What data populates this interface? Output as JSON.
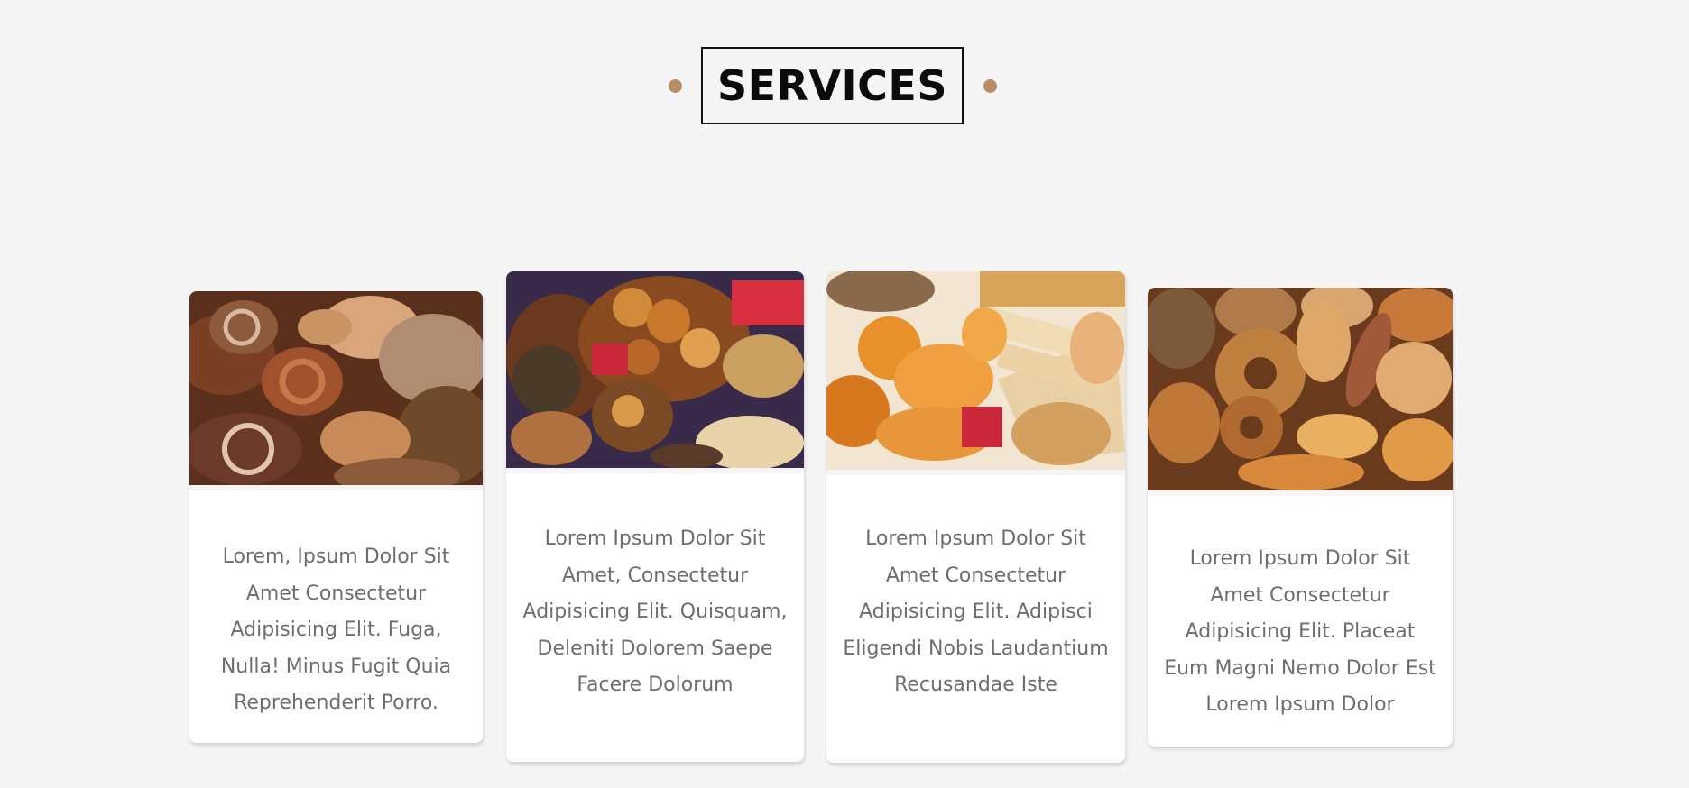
{
  "section": {
    "title": "SERVICES"
  },
  "cards": [
    {
      "image_icon": "bread-photo-icon",
      "text": "Lorem, Ipsum Dolor Sit Amet Consectetur Adipisicing Elit. Fuga, Nulla! Minus Fugit Quia Reprehenderit Porro."
    },
    {
      "image_icon": "bread-basket-photo-icon",
      "text": "Lorem Ipsum Dolor Sit Amet, Consectetur Adipisicing Elit. Quisquam, Deleniti Dolorem Saepe Facere Dolorum"
    },
    {
      "image_icon": "croissant-photo-icon",
      "text": "Lorem Ipsum Dolor Sit Amet Consectetur Adipisicing Elit. Adipisci Eligendi Nobis Laudantium Recusandae Iste"
    },
    {
      "image_icon": "bakery-assortment-photo-icon",
      "text": "Lorem Ipsum Dolor Sit Amet Consectetur Adipisicing Elit. Placeat Eum Magni Nemo Dolor Est Lorem Ipsum Dolor"
    }
  ],
  "colors": {
    "background": "#f5f5f5",
    "accent_dot": "#b88d64",
    "card_text": "#6e6e6e",
    "heading": "#0b0b0b"
  }
}
